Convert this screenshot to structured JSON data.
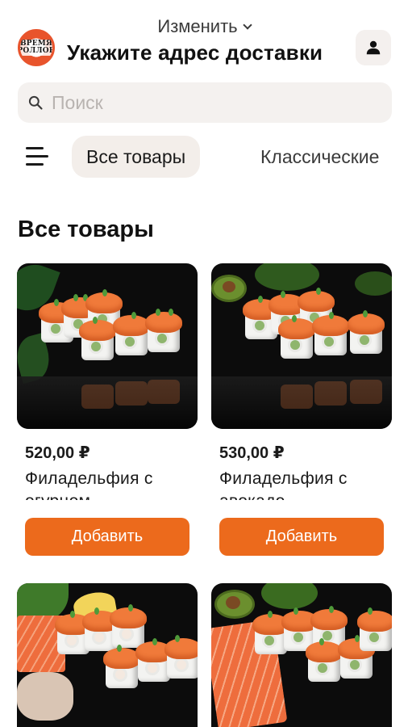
{
  "header": {
    "change_label": "Изменить",
    "address_label": "Укажите адрес доставки",
    "logo_text": "ВРЕМЯ\nРОЛЛОВ"
  },
  "search": {
    "placeholder": "Поиск"
  },
  "categories": {
    "active": "Все товары",
    "next": "Классические"
  },
  "section": {
    "title": "Все товары"
  },
  "products": [
    {
      "price": "520,00 ₽",
      "name": "Филадельфия с огурцом",
      "button": "Добавить"
    },
    {
      "price": "530,00 ₽",
      "name": "Филадельфия с авокадо",
      "button": "Добавить"
    }
  ],
  "colors": {
    "accent": "#ec6a1c",
    "pill_bg": "#f3eeea",
    "search_bg": "#f4f1ef"
  }
}
